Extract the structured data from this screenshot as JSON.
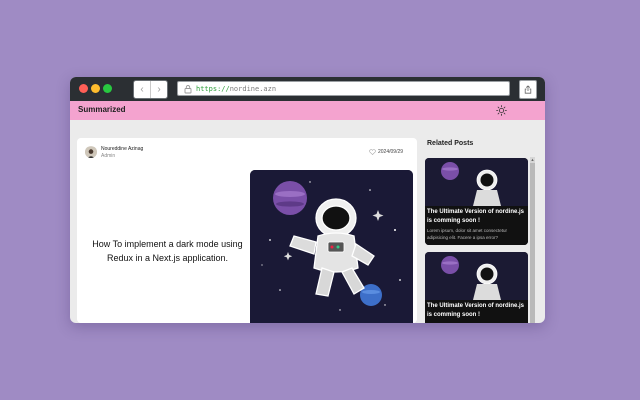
{
  "browser": {
    "url_protocol": "https://",
    "url_host": "nordine.azn"
  },
  "header": {
    "brand": "Summarized",
    "theme_toggle_icon": "sun-icon"
  },
  "post": {
    "author_name": "Noureddine Azinag",
    "author_role": "Admin",
    "date": "2024/09/29",
    "title": "How To implement a dark mode using Redux in a Next.js application."
  },
  "sidebar": {
    "title": "Related Posts",
    "items": [
      {
        "title": "The Ultimate Version of nordine.js is comming soon !",
        "excerpt": "Lorem ipsum, dolor sit amet consectetur adipisicing elit. Facere a ipsa error?"
      },
      {
        "title": "The Ultimate Version of nordine.js is comming soon !",
        "excerpt": ""
      }
    ]
  },
  "colors": {
    "background": "#9f8bc4",
    "header": "#f4a3cf",
    "titlebar": "#2b2f33"
  }
}
